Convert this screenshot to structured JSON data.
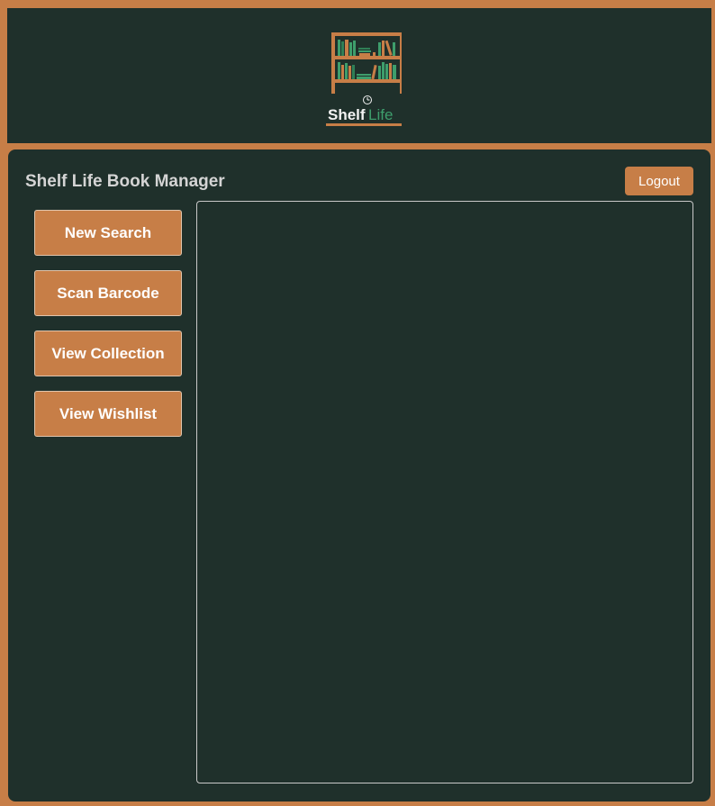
{
  "header": {
    "logo": {
      "text_part1": "Shelf",
      "text_part2": "Life",
      "icon": "bookshelf-clock-icon"
    }
  },
  "app": {
    "title": "Shelf Life Book Manager",
    "logout_label": "Logout"
  },
  "nav": {
    "items": [
      {
        "label": "New Search"
      },
      {
        "label": "Scan Barcode"
      },
      {
        "label": "View Collection"
      },
      {
        "label": "View Wishlist"
      }
    ]
  },
  "colors": {
    "accent": "#c77e47",
    "background": "#1f302b",
    "text_light": "#d4d4d4",
    "logo_green": "#3e9e6c",
    "logo_white": "#f2f2f2"
  }
}
